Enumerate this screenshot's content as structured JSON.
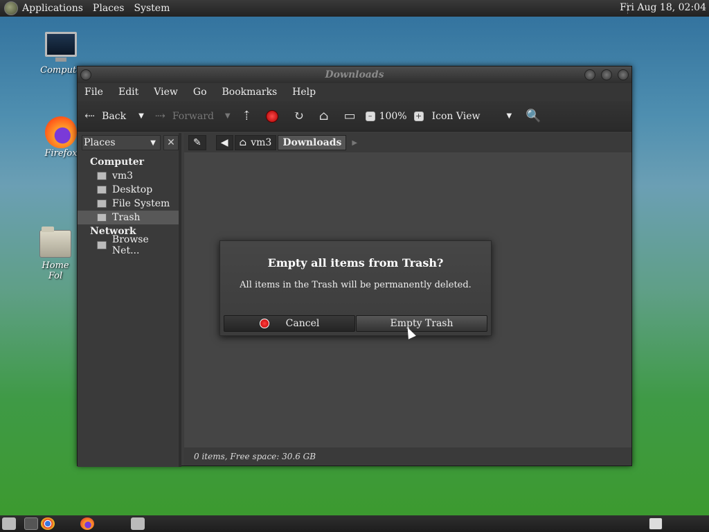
{
  "top_panel": {
    "menus": [
      "Applications",
      "Places",
      "System"
    ],
    "clock": "Fri Aug 18, 02:04"
  },
  "desktop": {
    "icons": [
      {
        "label": "Compute",
        "icon": "computer-icon"
      },
      {
        "label": "Firefox",
        "icon": "firefox-icon"
      },
      {
        "label": "Home Fol",
        "icon": "home-folder-icon"
      }
    ]
  },
  "window": {
    "title": "Downloads",
    "menubar": [
      "File",
      "Edit",
      "View",
      "Go",
      "Bookmarks",
      "Help"
    ],
    "toolbar": {
      "back": "Back",
      "forward": "Forward",
      "zoom": "100%",
      "view_mode": "Icon View"
    },
    "sidebar": {
      "selector": "Places",
      "sections": [
        {
          "title": "Computer",
          "items": [
            "vm3",
            "Desktop",
            "File System",
            "Trash"
          ]
        },
        {
          "title": "Network",
          "items": [
            "Browse Net..."
          ]
        }
      ],
      "selected": "Trash"
    },
    "path": [
      "vm3",
      "Downloads"
    ],
    "status": "0 items, Free space: 30.6 GB"
  },
  "dialog": {
    "heading": "Empty all items from Trash?",
    "message": "All items in the Trash will be permanently deleted.",
    "cancel": "Cancel",
    "confirm": "Empty Trash"
  }
}
